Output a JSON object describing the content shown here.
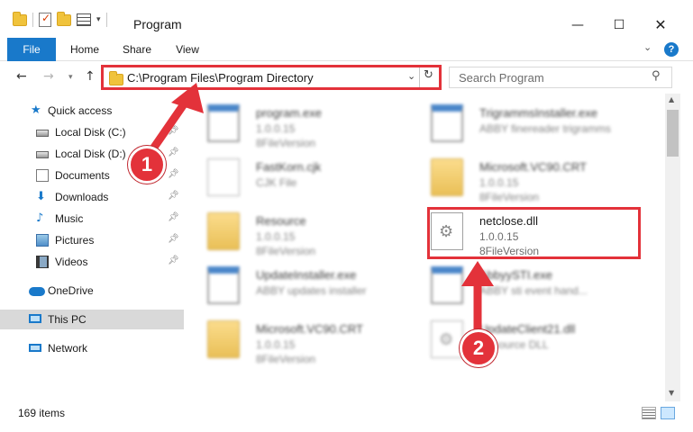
{
  "window": {
    "title": "Program",
    "minimize_glyph": "—",
    "maximize_glyph": "☐",
    "close_glyph": "✕"
  },
  "ribbon": {
    "tabs": [
      "File",
      "Home",
      "Share",
      "View"
    ],
    "help_label": "?"
  },
  "address_bar": {
    "path": "C:\\Program Files\\Program Directory",
    "search_placeholder": "Search Program"
  },
  "nav_pane": {
    "items": [
      {
        "label": "Quick access",
        "icon": "star-icon"
      },
      {
        "label": "Local Disk (C:)",
        "icon": "disk-icon",
        "pinned": true
      },
      {
        "label": "Local Disk (D:)",
        "icon": "disk-icon",
        "pinned": true
      },
      {
        "label": "Documents",
        "icon": "documents-icon",
        "pinned": true
      },
      {
        "label": "Downloads",
        "icon": "download-icon",
        "pinned": true
      },
      {
        "label": "Music",
        "icon": "music-icon",
        "pinned": true
      },
      {
        "label": "Pictures",
        "icon": "pictures-icon",
        "pinned": true
      },
      {
        "label": "Videos",
        "icon": "videos-icon",
        "pinned": true
      },
      {
        "label": "OneDrive",
        "icon": "cloud-icon"
      },
      {
        "label": "This PC",
        "icon": "computer-icon",
        "selected": true
      },
      {
        "label": "Network",
        "icon": "network-icon"
      }
    ]
  },
  "files": [
    {
      "name": "program.exe",
      "line1": "1.0.0.15",
      "line2": "8FileVersion",
      "type": "exe"
    },
    {
      "name": "TrigrammsInstaller.exe",
      "line1": "ABBY finereader trigramms",
      "line2": "",
      "type": "exe"
    },
    {
      "name": "FastKorn.cjk",
      "line1": "CJK File",
      "line2": "",
      "type": "doc"
    },
    {
      "name": "Microsoft.VC90.CRT",
      "line1": "1.0.0.15",
      "line2": "8FileVersion",
      "type": "folder"
    },
    {
      "name": "Resource",
      "line1": "1.0.0.15",
      "line2": "8FileVersion",
      "type": "folder"
    },
    {
      "name": "netclose.dll",
      "line1": "1.0.0.15",
      "line2": "8FileVersion",
      "type": "dll"
    },
    {
      "name": "UpdateInstaller.exe",
      "line1": "ABBY updates installer",
      "line2": "",
      "type": "exe"
    },
    {
      "name": "AbbyySTI.exe",
      "line1": "ABBY sti event hand...",
      "line2": "",
      "type": "exe"
    },
    {
      "name": "Microsoft.VC90.CRT",
      "line1": "1.0.0.15",
      "line2": "8FileVersion",
      "type": "folder"
    },
    {
      "name": "UpdateClient21.dll",
      "line1": "Resource DLL",
      "line2": "",
      "type": "dll"
    }
  ],
  "status_bar": {
    "item_count": "169 items"
  },
  "callouts": {
    "step1": "1",
    "step2": "2",
    "color": "#e3323a"
  },
  "colors": {
    "accent": "#1979ca",
    "highlight": "#e3323a"
  }
}
